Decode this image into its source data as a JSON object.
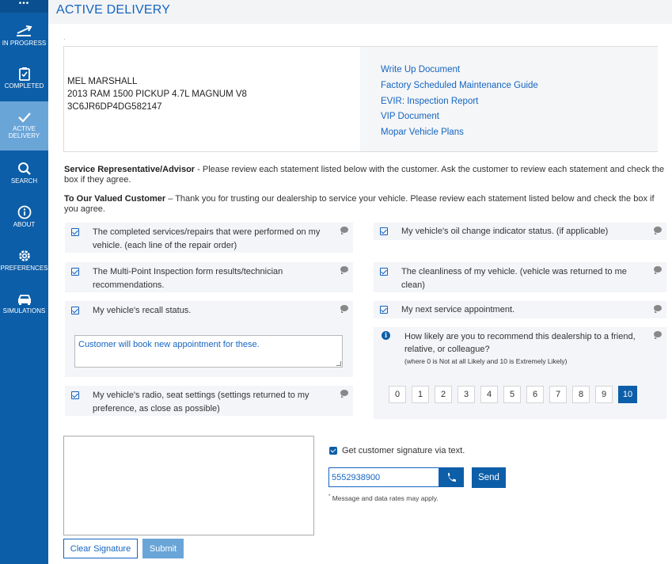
{
  "sidebar": {
    "more": "•••",
    "items": [
      {
        "label": "IN PROGRESS"
      },
      {
        "label": "COMPLETED"
      },
      {
        "label": "ACTIVE DELIVERY"
      },
      {
        "label": "SEARCH"
      },
      {
        "label": "ABOUT"
      },
      {
        "label": "PREFERENCES"
      },
      {
        "label": "SIMULATIONS"
      }
    ]
  },
  "page": {
    "title": "ACTIVE DELIVERY",
    "dot": "."
  },
  "vehicle": {
    "owner": "MEL MARSHALL",
    "model": "2013 RAM 1500 PICKUP 4.7L MAGNUM V8",
    "vin": "3C6JR6DP4DG582147"
  },
  "documents": [
    "Write Up Document",
    "Factory Scheduled Maintenance Guide",
    "EVIR: Inspection Report",
    "VIP Document",
    "Mopar Vehicle Plans"
  ],
  "instructions": {
    "advisor_label": "Service Representative/Advisor",
    "advisor_text": " - Please review each statement listed below with the customer. Ask the customer to review each statement and check the box if they agree.",
    "customer_label": "To Our Valued Customer",
    "customer_text": " – Thank you for trusting our dealership to service your vehicle. Please review each statement listed below and check the box if you agree."
  },
  "statements": {
    "services": "The completed services/repairs that were performed on my vehicle. (each line of the repair order)",
    "inspection": "The Multi-Point Inspection form results/technician recommendations.",
    "recall": "My vehicle's recall status.",
    "radio": "My vehicle's radio, seat settings (settings returned to my preference, as close as possible)",
    "oil": "My vehicle's oil change indicator status. (if applicable)",
    "clean": "The cleanliness of my vehicle. (vehicle was returned to me clean)",
    "appointment": "My next service appointment."
  },
  "recall_note": "Customer will book new appointment for these.",
  "survey": {
    "question": "How likely are you to recommend this dealership to a friend, relative, or colleague?",
    "scale_note": "(where 0 is Not at all Likely and 10 is Extremely Likely)",
    "options": [
      "0",
      "1",
      "2",
      "3",
      "4",
      "5",
      "6",
      "7",
      "8",
      "9",
      "10"
    ],
    "selected": "10"
  },
  "signature": {
    "text_option": "Get customer signature via text.",
    "phone": "5552938900",
    "send_label": "Send",
    "rates_note": "Message and data rates may apply.",
    "asterisk": "*",
    "clear_label": "Clear Signature",
    "submit_label": "Submit"
  },
  "colors": {
    "brand": "#0d5ea8",
    "link": "#1565c0",
    "active_nav": "#6aa5d8"
  }
}
